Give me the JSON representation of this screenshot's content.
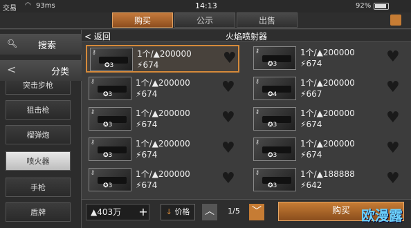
{
  "status": {
    "carrier": "交易",
    "speed": "93ms",
    "time": "14:13",
    "battery": "92%",
    "wifi_icon": "wifi-icon"
  },
  "tabs": [
    {
      "label": "购买",
      "active": true
    },
    {
      "label": "公示",
      "active": false
    },
    {
      "label": "出售",
      "active": false
    }
  ],
  "sidebar": {
    "search_label": "搜索",
    "category_label": "分类",
    "items": [
      {
        "label": "突击步枪"
      },
      {
        "label": "狙击枪"
      },
      {
        "label": "榴弹炮"
      },
      {
        "label": "喷火器"
      },
      {
        "label": "手枪"
      },
      {
        "label": "盾牌"
      }
    ]
  },
  "main": {
    "back_label": "返回",
    "title": "火焰喷射器",
    "listings": [
      {
        "level": "3",
        "qty": "1个/▲200000",
        "price": "674"
      },
      {
        "level": "3",
        "qty": "1个/▲200000",
        "price": "674"
      },
      {
        "level": "3",
        "qty": "1个/▲200000",
        "price": "674"
      },
      {
        "level": "4",
        "qty": "1个/▲200000",
        "price": "667"
      },
      {
        "level": "3",
        "qty": "1个/▲200000",
        "price": "674"
      },
      {
        "level": "3",
        "qty": "1个/▲200000",
        "price": "674"
      },
      {
        "level": "3",
        "qty": "1个/▲200000",
        "price": "674"
      },
      {
        "level": "3",
        "qty": "1个/▲200000",
        "price": "674"
      },
      {
        "level": "3",
        "qty": "1个/▲200000",
        "price": "674"
      },
      {
        "level": "3",
        "qty": "1个/▲188888",
        "price": "642"
      }
    ]
  },
  "bottom": {
    "balance": "▲403万",
    "sort_label": "价格",
    "page": "1/5",
    "buy_label": "购买"
  },
  "watermark": "欧漫露"
}
